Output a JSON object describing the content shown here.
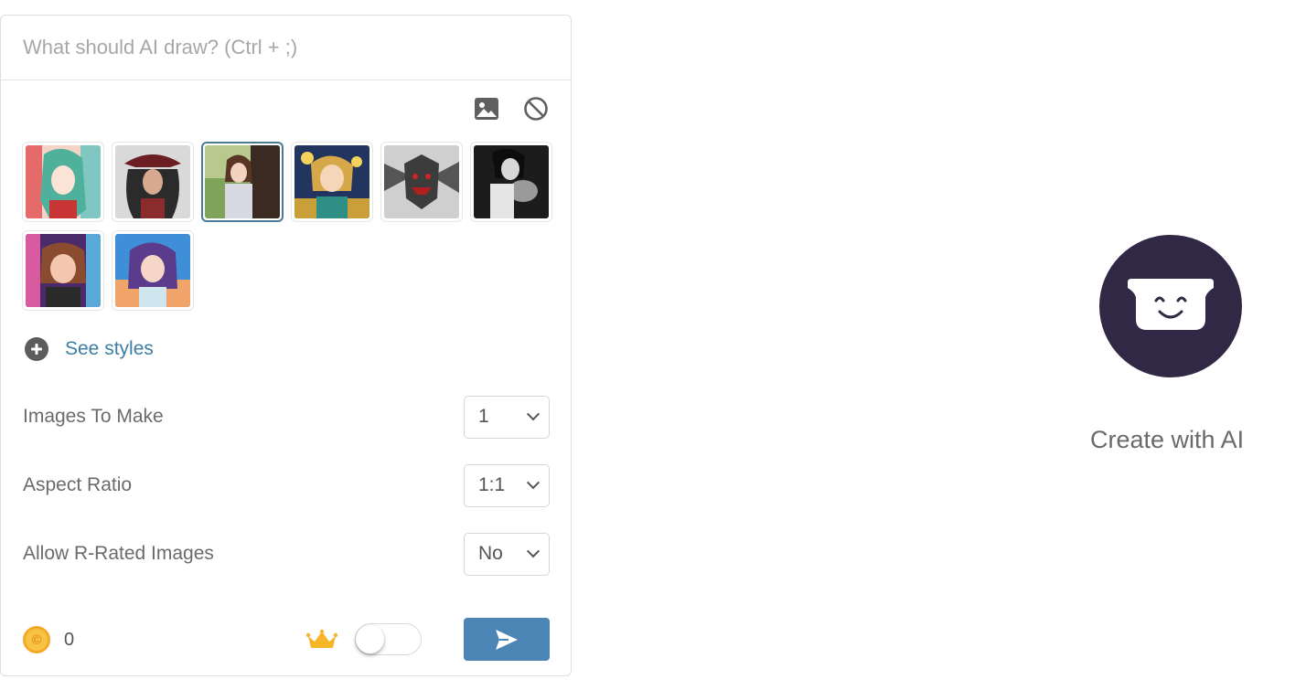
{
  "prompt": {
    "placeholder": "What should AI draw? (Ctrl + ;)",
    "value": ""
  },
  "tools": {
    "image_icon": "image-icon",
    "clear_icon": "block-icon"
  },
  "styles": {
    "items": [
      {
        "id": "style-1",
        "selected": false
      },
      {
        "id": "style-2",
        "selected": false
      },
      {
        "id": "style-3",
        "selected": true
      },
      {
        "id": "style-4",
        "selected": false
      },
      {
        "id": "style-5",
        "selected": false
      },
      {
        "id": "style-6",
        "selected": false
      },
      {
        "id": "style-7",
        "selected": false
      },
      {
        "id": "style-8",
        "selected": false
      }
    ],
    "see_styles_label": "See styles"
  },
  "settings": {
    "images_to_make": {
      "label": "Images To Make",
      "value": "1"
    },
    "aspect_ratio": {
      "label": "Aspect Ratio",
      "value": "1:1"
    },
    "allow_r_rated": {
      "label": "Allow R-Rated Images",
      "value": "No"
    }
  },
  "footer": {
    "coin_count": "0",
    "toggle_on": false
  },
  "right": {
    "create_label": "Create with AI"
  },
  "colors": {
    "accent": "#4a85b5",
    "link": "#3d7ea6",
    "mascot_bg": "#312845",
    "selected_border": "#4a7a96"
  }
}
